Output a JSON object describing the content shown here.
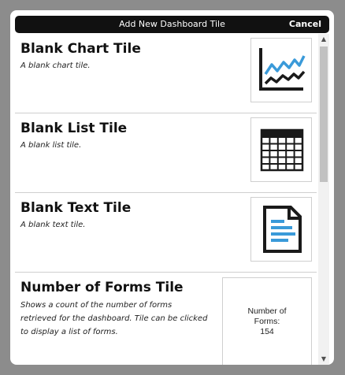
{
  "dialog": {
    "title": "Add New Dashboard Tile",
    "cancel_label": "Cancel"
  },
  "tiles": [
    {
      "title": "Blank Chart Tile",
      "description": "A blank chart tile.",
      "icon": "line-chart-icon"
    },
    {
      "title": "Blank List Tile",
      "description": "A blank list tile.",
      "icon": "table-grid-icon"
    },
    {
      "title": "Blank Text Tile",
      "description": "A blank text tile.",
      "icon": "text-document-icon"
    },
    {
      "title": "Number of Forms Tile",
      "description": "Shows a count of the number of forms retrieved for the dashboard. Tile can be clicked to display a list of forms.",
      "preview_label": "Number of Forms:",
      "preview_value": "154"
    }
  ],
  "colors": {
    "accent_blue": "#3a9ad9",
    "header_bg": "#111111",
    "backdrop": "#8c8c8c"
  }
}
